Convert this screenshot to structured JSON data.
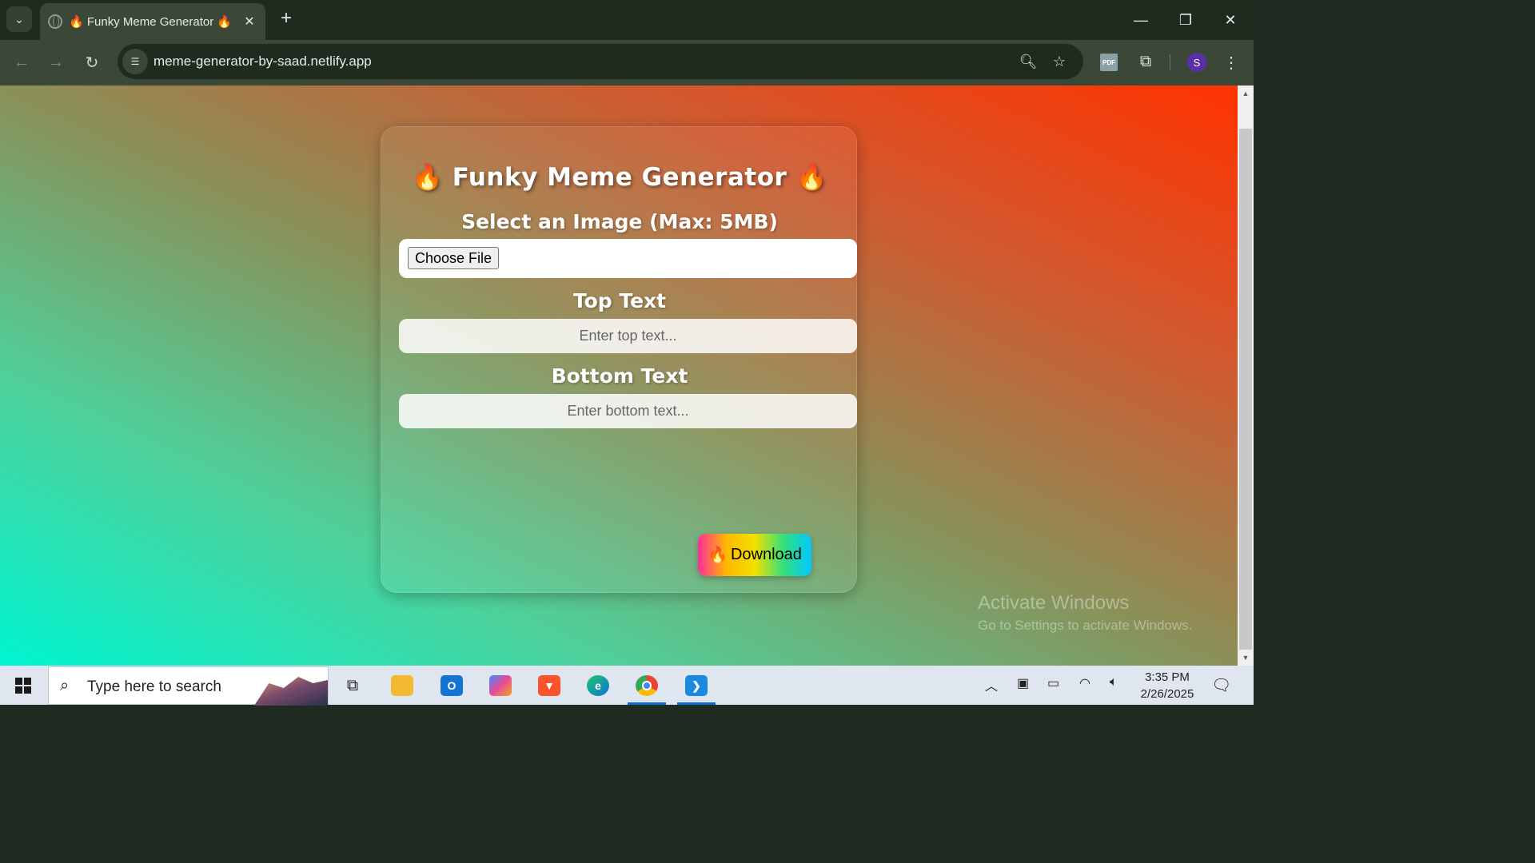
{
  "browser": {
    "tab_title": "🔥 Funky Meme Generator 🔥",
    "url": "meme-generator-by-saad.netlify.app",
    "avatar_letter": "S",
    "pdf_label": "PDF"
  },
  "app": {
    "title": "🔥 Funky Meme Generator 🔥",
    "image_label": "Select an Image (Max: 5MB)",
    "file_button": "Choose File",
    "top_label": "Top Text",
    "top_placeholder": "Enter top text...",
    "bottom_label": "Bottom Text",
    "bottom_placeholder": "Enter bottom text...",
    "download_icon": "🔥",
    "download_label": "Download"
  },
  "watermark": {
    "line1": "Activate Windows",
    "line2": "Go to Settings to activate Windows."
  },
  "taskbar": {
    "search_placeholder": "Type here to search",
    "time": "3:35 PM",
    "date": "2/26/2025",
    "apps": [
      "task-view",
      "file-explorer",
      "outlook",
      "copilot",
      "brave",
      "edge",
      "chrome",
      "vscode"
    ],
    "active_apps": [
      "chrome",
      "vscode"
    ]
  },
  "colors": {
    "gradient_start": "#00f5d0",
    "gradient_end": "#ff3300"
  }
}
